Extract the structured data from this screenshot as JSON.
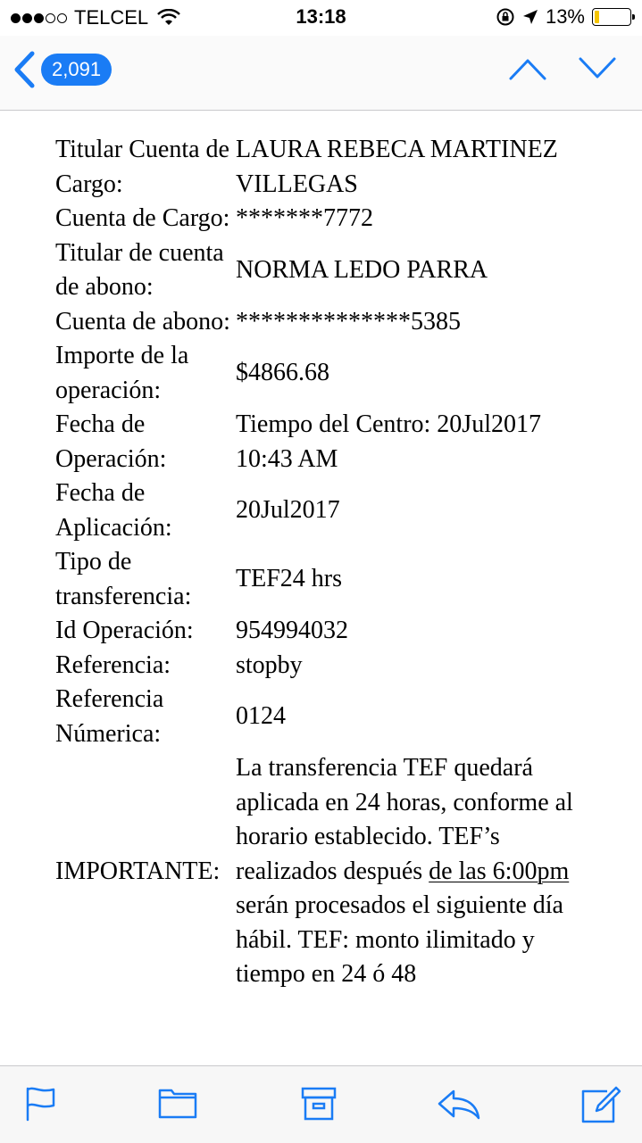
{
  "status_bar": {
    "carrier": "TELCEL",
    "time": "13:18",
    "battery": "13%",
    "battery_level": 0.13,
    "signal_bars": 3
  },
  "nav": {
    "unread_count": "2,091",
    "accent_color": "#1a7cf5"
  },
  "email": {
    "rows": [
      {
        "label": "Titular Cuenta de Cargo:",
        "value": "LAURA REBECA MARTINEZ VILLEGAS"
      },
      {
        "label": "Cuenta de Cargo:",
        "value": "*******7772"
      },
      {
        "label": "Titular de cuenta de abono:",
        "value": "NORMA LEDO PARRA"
      },
      {
        "label": "Cuenta de abono:",
        "value": "**************5385"
      },
      {
        "label": "Importe de la operación:",
        "value": "$4866.68"
      },
      {
        "label": "Fecha de Operación:",
        "value": "Tiempo del Centro: 20Jul2017 10:43 AM"
      },
      {
        "label": "Fecha de Aplicación:",
        "value": "20Jul2017"
      },
      {
        "label": "Tipo de transferencia:",
        "value": "TEF24 hrs"
      },
      {
        "label": "Id Operación:",
        "value": "954994032"
      },
      {
        "label": "Referencia:",
        "value": "stopby"
      },
      {
        "label": "Referencia Númerica:",
        "value": "0124"
      }
    ],
    "important": {
      "label": "IMPORTANTE:",
      "text_before": "La transferencia TEF quedará aplicada en 24 horas, conforme al horario establecido. TEF’s realizados después ",
      "link_text": "de las 6:00pm",
      "text_after": " serán procesados el siguiente día hábil. TEF: monto ilimitado y tiempo en 24 ó 48"
    }
  },
  "toolbar": {
    "icons": [
      "flag-icon",
      "folder-icon",
      "archive-icon",
      "reply-icon",
      "compose-icon"
    ]
  }
}
